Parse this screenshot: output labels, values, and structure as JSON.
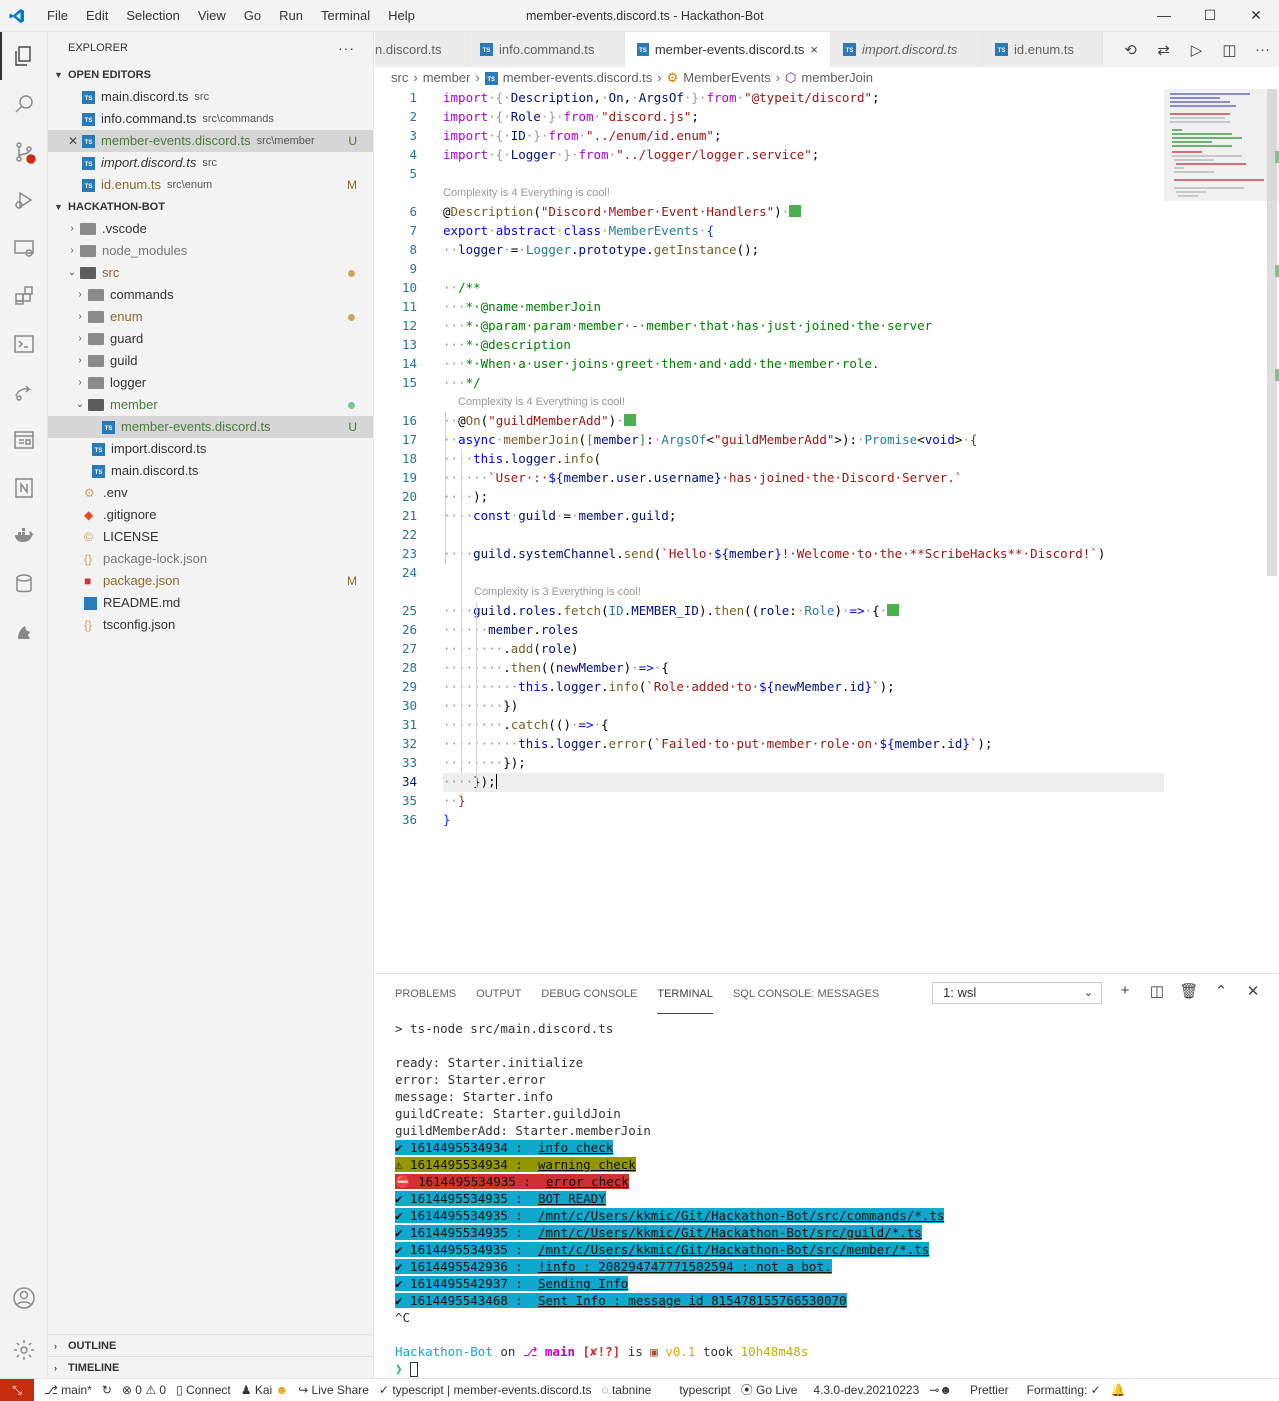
{
  "window": {
    "title": "member-events.discord.ts - Hackathon-Bot"
  },
  "menu": [
    "File",
    "Edit",
    "Selection",
    "View",
    "Go",
    "Run",
    "Terminal",
    "Help"
  ],
  "explorer": {
    "header": "EXPLORER",
    "open_editors_label": "OPEN EDITORS",
    "open_editors": [
      {
        "name": "main.discord.ts",
        "desc": "src",
        "status": "",
        "italic": false
      },
      {
        "name": "info.command.ts",
        "desc": "src\\commands",
        "status": "",
        "italic": false
      },
      {
        "name": "member-events.discord.ts",
        "desc": "src\\member",
        "status": "U",
        "italic": false
      },
      {
        "name": "import.discord.ts",
        "desc": "src",
        "status": "",
        "italic": true
      },
      {
        "name": "id.enum.ts",
        "desc": "src\\enum",
        "status": "M",
        "italic": false
      }
    ],
    "project_label": "HACKATHON-BOT",
    "tree": [
      {
        "name": ".vscode",
        "type": "folder"
      },
      {
        "name": "node_modules",
        "type": "folder"
      },
      {
        "name": "src",
        "type": "folder-open"
      },
      {
        "name": "commands",
        "type": "folder"
      },
      {
        "name": "enum",
        "type": "folder"
      },
      {
        "name": "guard",
        "type": "folder"
      },
      {
        "name": "guild",
        "type": "folder"
      },
      {
        "name": "logger",
        "type": "folder"
      },
      {
        "name": "member",
        "type": "folder-open"
      },
      {
        "name": "member-events.discord.ts",
        "type": "ts",
        "status": "U"
      },
      {
        "name": "import.discord.ts",
        "type": "ts"
      },
      {
        "name": "main.discord.ts",
        "type": "ts"
      },
      {
        "name": ".env",
        "type": "env"
      },
      {
        "name": ".gitignore",
        "type": "git"
      },
      {
        "name": "LICENSE",
        "type": "license"
      },
      {
        "name": "package-lock.json",
        "type": "json"
      },
      {
        "name": "package.json",
        "type": "npm",
        "status": "M"
      },
      {
        "name": "README.md",
        "type": "md"
      },
      {
        "name": "tsconfig.json",
        "type": "json"
      }
    ],
    "outline_label": "OUTLINE",
    "timeline_label": "TIMELINE"
  },
  "tabs": [
    {
      "label": "n.discord.ts"
    },
    {
      "label": "info.command.ts"
    },
    {
      "label": "member-events.discord.ts",
      "close": "×"
    },
    {
      "label": "import.discord.ts"
    },
    {
      "label": "id.enum.ts"
    }
  ],
  "breadcrumbs": [
    "src",
    "member",
    "member-events.discord.ts",
    "MemberEvents",
    "memberJoin"
  ],
  "code": {
    "line_numbers": [
      "1",
      "2",
      "3",
      "4",
      "5",
      "6",
      "7",
      "8",
      "9",
      "10",
      "11",
      "12",
      "13",
      "14",
      "15",
      "16",
      "17",
      "18",
      "19",
      "20",
      "21",
      "22",
      "23",
      "24",
      "25",
      "26",
      "27",
      "28",
      "29",
      "30",
      "31",
      "32",
      "33",
      "34",
      "35",
      "36"
    ],
    "lens1": "Complexity is 4 Everything is cool!",
    "lens2": "Complexity is 4 Everything is cool!",
    "lens3": "Complexity is 3 Everything is cool!"
  },
  "panel": {
    "tabs": [
      "PROBLEMS",
      "OUTPUT",
      "DEBUG CONSOLE",
      "TERMINAL",
      "SQL CONSOLE: MESSAGES"
    ],
    "terminal_select": "1: wsl",
    "lines": [
      "> ts-node src/main.discord.ts",
      "",
      "ready: Starter.initialize",
      "error: Starter.error",
      "message: Starter.info",
      "guildCreate: Starter.guildJoin",
      "guildMemberAdd: Starter.memberJoin"
    ],
    "logs": [
      {
        "style": "cy",
        "prefix": "✔ 1614495534934 :  ",
        "msg": "info check"
      },
      {
        "style": "ye",
        "prefix": "⚠ 1614495534934 :  ",
        "msg": "warning check"
      },
      {
        "style": "re",
        "prefix": "⛔ 1614495534935 :  ",
        "msg": "error check"
      },
      {
        "style": "cy",
        "prefix": "✔ 1614495534935 :  ",
        "msg": "BOT READY"
      },
      {
        "style": "cy",
        "prefix": "✔ 1614495534935 :  ",
        "msg": "/mnt/c/Users/kkmic/Git/Hackathon-Bot/src/commands/*.ts"
      },
      {
        "style": "cy",
        "prefix": "✔ 1614495534935 :  ",
        "msg": "/mnt/c/Users/kkmic/Git/Hackathon-Bot/src/guild/*.ts"
      },
      {
        "style": "cy",
        "prefix": "✔ 1614495534935 :  ",
        "msg": "/mnt/c/Users/kkmic/Git/Hackathon-Bot/src/member/*.ts"
      },
      {
        "style": "cy",
        "prefix": "✔ 1614495542936 :  ",
        "msg": "!info : 208294747771502594 : not a bot."
      },
      {
        "style": "cy",
        "prefix": "✔ 1614495542937 :  ",
        "msg": "Sending Info"
      },
      {
        "style": "cy",
        "prefix": "✔ 1614495543468 :  ",
        "msg": "Sent Info : message id 815478155766530070"
      }
    ],
    "ctrl_c": "^C",
    "prompt_dir": "Hackathon-Bot",
    "prompt_on": " on ",
    "prompt_branch": "main",
    "prompt_status": "[✘!?]",
    "prompt_is": " is ",
    "prompt_version": "v0.1",
    "prompt_took": " took ",
    "prompt_time": "10h48m48s",
    "prompt_char": "❯"
  },
  "statusbar": {
    "branch": "main*",
    "problems": "⊗ 0 ⚠ 0",
    "connect": "Connect",
    "kai": "Kai",
    "liveshare": "Live Share",
    "lang_check": "typescript | member-events.discord.ts",
    "tabnine": "tabnine",
    "language": "typescript",
    "golive": "Go Live",
    "version": "4.3.0-dev.20210223",
    "prettier": "Prettier",
    "formatting": "Formatting: ✓"
  },
  "colors": {
    "accent": "#007acc",
    "ts": "#2b7ab8",
    "untracked": "#4b7a3c",
    "modified": "#8a6a2c",
    "remote": "#c72e0f"
  }
}
